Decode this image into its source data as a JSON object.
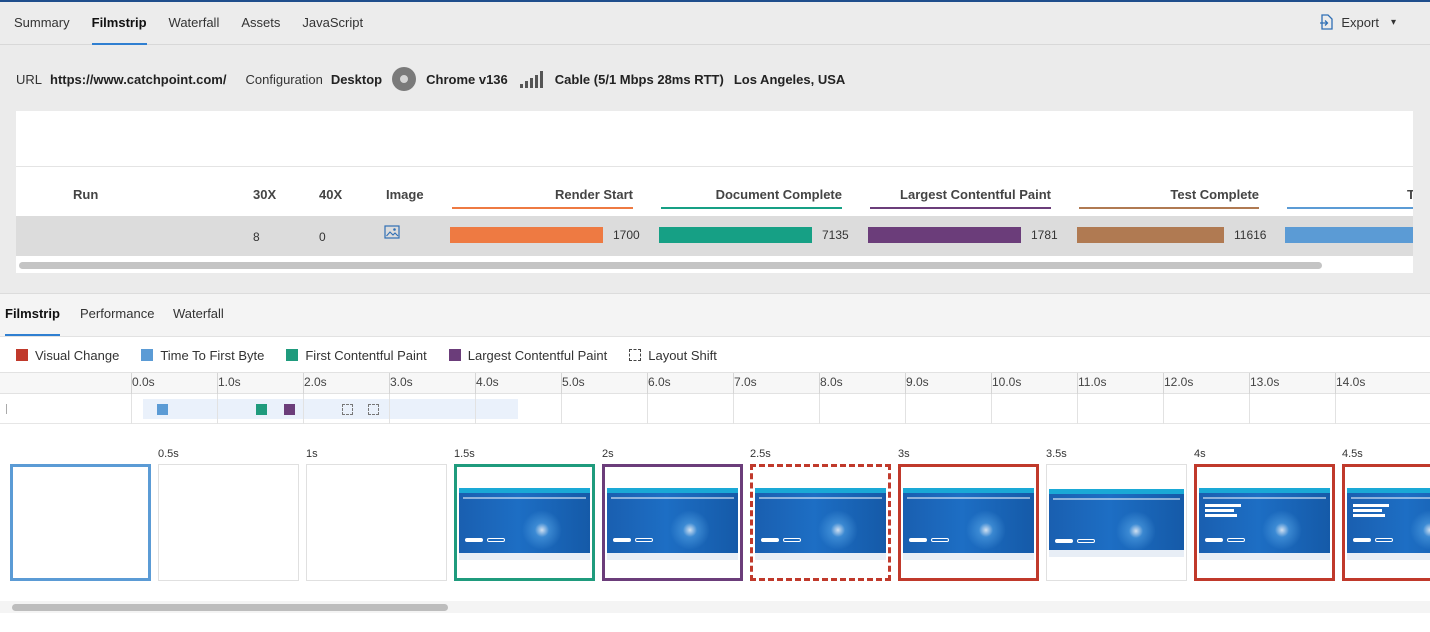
{
  "top_tabs": [
    "Summary",
    "Filmstrip",
    "Waterfall",
    "Assets",
    "JavaScript"
  ],
  "top_tabs_active": "Filmstrip",
  "export": {
    "label": "Export",
    "icon": "export-icon",
    "caret": "▾"
  },
  "meta": {
    "url_label": "URL",
    "url": "https://www.catchpoint.com/",
    "config_label": "Configuration",
    "config": "Desktop",
    "browser_icon": "chrome-icon",
    "browser": "Chrome v136",
    "network_icon": "signal-bars-icon",
    "network": "Cable (5/1 Mbps 28ms RTT)",
    "location": "Los Angeles, USA"
  },
  "runs_table": {
    "headers": {
      "run": "Run",
      "c30x": "30X",
      "c40x": "40X",
      "image": "Image",
      "render_start": "Render Start",
      "document_complete": "Document Complete",
      "lcp": "Largest Contentful Paint",
      "test_complete": "Test Complete",
      "truncated": "To"
    },
    "row": {
      "run": "",
      "c30x": "8",
      "c40x": "0",
      "image_icon": "image-icon",
      "render_start": "1700",
      "document_complete": "7135",
      "lcp": "1781",
      "test_complete": "11616"
    },
    "colors": {
      "render_start": "#ee7a42",
      "document_complete": "#16a085",
      "lcp": "#6b3d7a",
      "test_complete": "#b07a52",
      "truncated": "#5b9bd5"
    }
  },
  "sub_tabs": [
    "Filmstrip",
    "Performance",
    "Waterfall"
  ],
  "sub_tabs_active": "Filmstrip",
  "legend": [
    {
      "label": "Visual Change",
      "color": "#c0392b"
    },
    {
      "label": "Time To First Byte",
      "color": "#5b9bd5"
    },
    {
      "label": "First Contentful Paint",
      "color": "#1f9b7d"
    },
    {
      "label": "Largest Contentful Paint",
      "color": "#6b3d7a"
    },
    {
      "label": "Layout Shift",
      "color": "#444444",
      "dashed": true
    }
  ],
  "timeline": {
    "ticks": [
      "0.0s",
      "1.0s",
      "2.0s",
      "3.0s",
      "4.0s",
      "5.0s",
      "6.0s",
      "7.0s",
      "8.0s",
      "9.0s",
      "10.0s",
      "11.0s",
      "12.0s",
      "13.0s",
      "14.0s"
    ],
    "span_end_s": 4.5,
    "markers": [
      {
        "type": "ttfb",
        "t": 0.3,
        "color": "#5b9bd5"
      },
      {
        "type": "fcp",
        "t": 1.45,
        "color": "#1f9b7d"
      },
      {
        "type": "lcp",
        "t": 1.78,
        "color": "#6b3d7a"
      },
      {
        "type": "layout-shift",
        "t": 2.45
      },
      {
        "type": "layout-shift",
        "t": 2.75
      }
    ]
  },
  "filmstrip": [
    {
      "label": "",
      "state": "selected",
      "content": "blank"
    },
    {
      "label": "0.5s",
      "state": "none",
      "content": "blank"
    },
    {
      "label": "1s",
      "state": "none",
      "content": "blank"
    },
    {
      "label": "1.5s",
      "state": "fcp",
      "content": "page"
    },
    {
      "label": "2s",
      "state": "lcp",
      "content": "page"
    },
    {
      "label": "2.5s",
      "state": "layout-shift",
      "content": "page"
    },
    {
      "label": "3s",
      "state": "visual-change",
      "content": "page"
    },
    {
      "label": "3.5s",
      "state": "none",
      "content": "page-plain"
    },
    {
      "label": "4s",
      "state": "visual-change",
      "content": "page-text"
    },
    {
      "label": "4.5s",
      "state": "visual-change",
      "content": "page-text"
    }
  ]
}
